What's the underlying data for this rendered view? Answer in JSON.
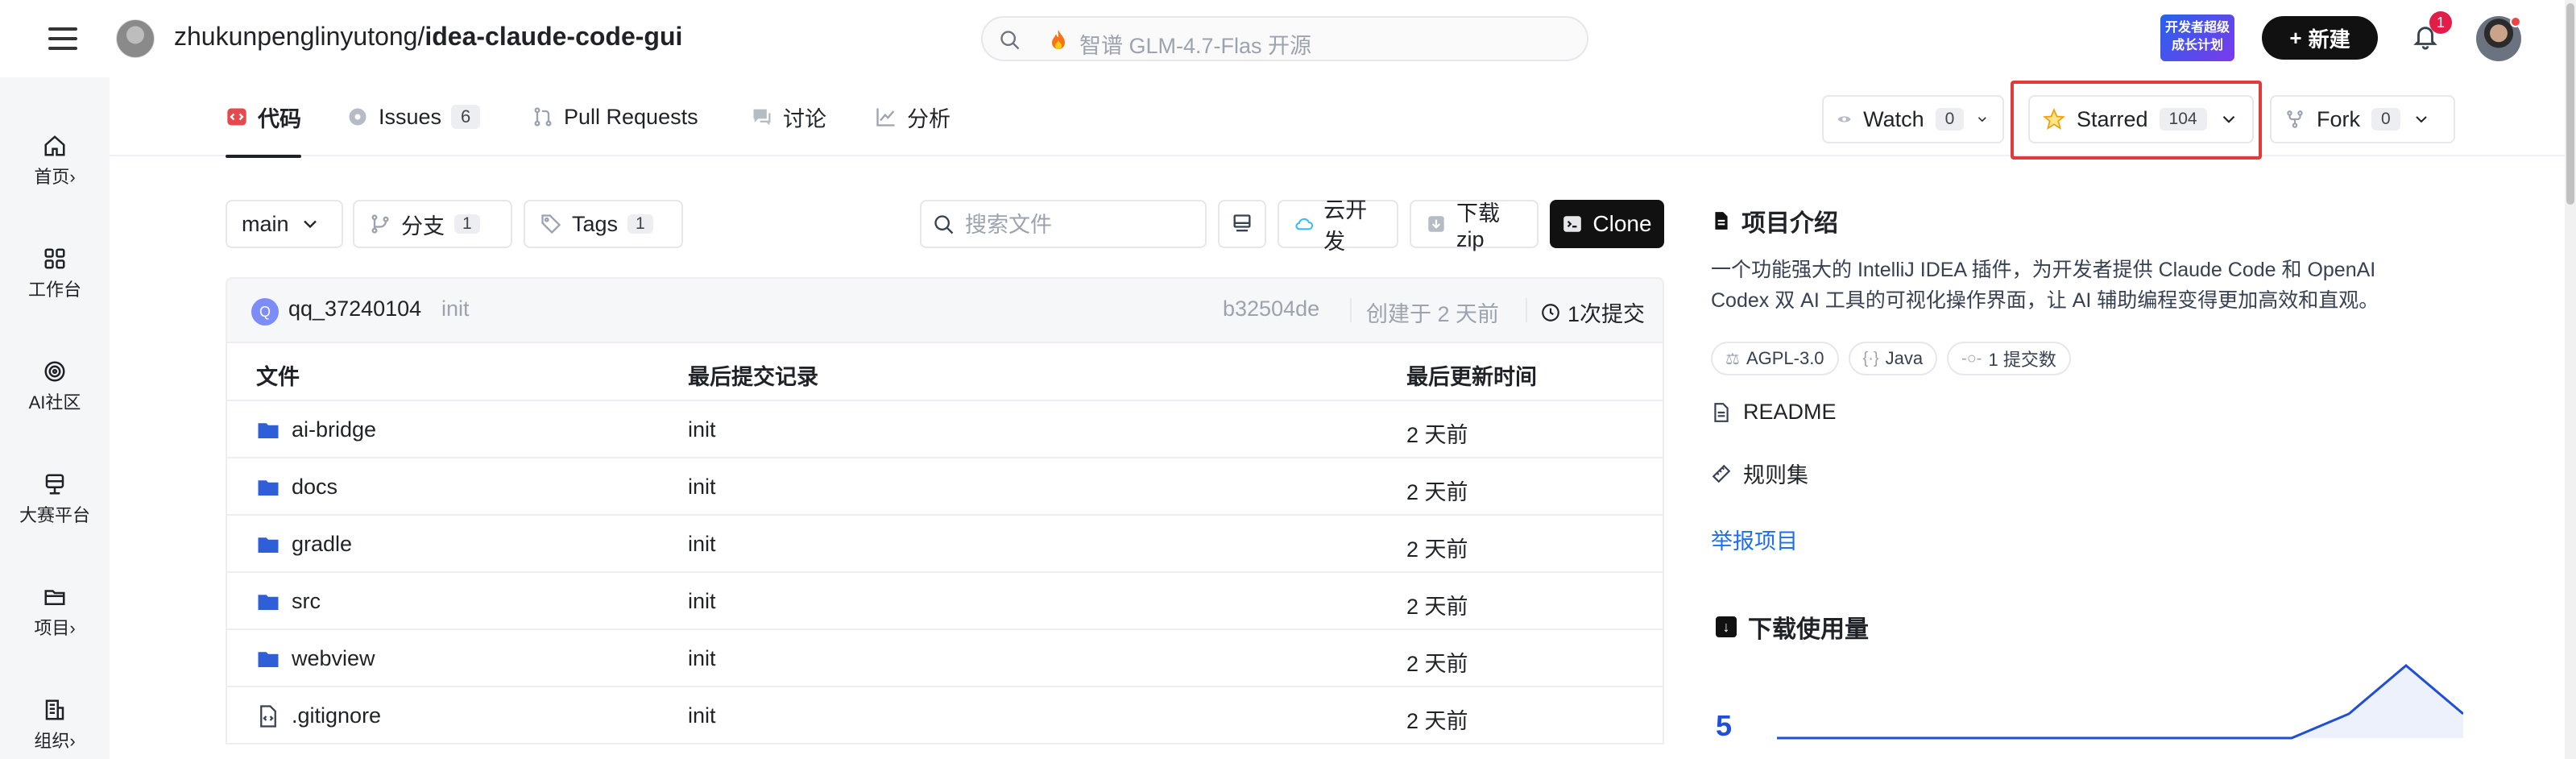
{
  "topbar": {
    "repo_owner": "zhukunpenglinyutong",
    "repo_sep": "/",
    "repo_name": "idea-claude-code-gui",
    "search_placeholder": "智谱 GLM-4.7-Flas 开源",
    "promo_badge": "开发者超级 成长计划",
    "new_button": "新建",
    "notification_count": "1"
  },
  "sidebar": {
    "items": [
      {
        "label": "首页",
        "chevron": "›",
        "icon": "home-icon"
      },
      {
        "label": "工作台",
        "icon": "grid-icon"
      },
      {
        "label": "AI社区",
        "icon": "ai-icon"
      },
      {
        "label": "大赛平台",
        "icon": "trophy-icon"
      },
      {
        "label": "项目",
        "chevron": "›",
        "icon": "folder-icon"
      },
      {
        "label": "组织",
        "chevron": "›",
        "icon": "building-icon"
      }
    ]
  },
  "tabs": [
    {
      "label": "代码",
      "icon": "code-icon"
    },
    {
      "label": "Issues",
      "count": "6",
      "icon": "issue-icon"
    },
    {
      "label": "Pull Requests",
      "icon": "pull-request-icon"
    },
    {
      "label": "讨论",
      "icon": "chat-icon"
    },
    {
      "label": "分析",
      "icon": "chart-icon"
    }
  ],
  "repo_actions": {
    "watch": {
      "label": "Watch",
      "count": "0"
    },
    "star": {
      "label": "Starred",
      "count": "104"
    },
    "fork": {
      "label": "Fork",
      "count": "0"
    }
  },
  "toolbar": {
    "branch": "main",
    "branches_label": "分支",
    "branches_count": "1",
    "tags_label": "Tags",
    "tags_count": "1",
    "search_placeholder": "搜索文件",
    "cloud_dev": "云开发",
    "download_zip": "下载zip",
    "clone": "Clone"
  },
  "last_commit": {
    "avatar_letter": "Q",
    "user": "qq_37240104",
    "message": "init",
    "hash": "b32504de",
    "created": "创建于 2 天前",
    "commits": "1次提交"
  },
  "file_table": {
    "headers": [
      "文件",
      "最后提交记录",
      "最后更新时间"
    ],
    "rows": [
      {
        "name": "ai-bridge",
        "type": "folder",
        "commit": "init",
        "time": "2 天前"
      },
      {
        "name": "docs",
        "type": "folder",
        "commit": "init",
        "time": "2 天前"
      },
      {
        "name": "gradle",
        "type": "folder",
        "commit": "init",
        "time": "2 天前"
      },
      {
        "name": "src",
        "type": "folder",
        "commit": "init",
        "time": "2 天前"
      },
      {
        "name": "webview",
        "type": "folder",
        "commit": "init",
        "time": "2 天前"
      },
      {
        "name": ".gitignore",
        "type": "file",
        "commit": "init",
        "time": "2 天前"
      }
    ]
  },
  "about": {
    "title": "项目介绍",
    "description": "一个功能强大的 IntelliJ IDEA 插件，为开发者提供 Claude Code 和 OpenAI Codex 双 AI 工具的可视化操作界面，让 AI 辅助编程变得更加高效和直观。",
    "tags": [
      "AGPL-3.0",
      "Java",
      "1 提交数"
    ],
    "readme": "README",
    "rules": "规则集",
    "report": "举报项目"
  },
  "downloads": {
    "title": "下载使用量",
    "value": "5",
    "chart_data": {
      "type": "area",
      "values": [
        0,
        0,
        0,
        0,
        0,
        0,
        0,
        0,
        0,
        0,
        1,
        3,
        1
      ],
      "color": "#1f4fd6"
    }
  },
  "colors": {
    "accent": "#1f6feb",
    "highlight_border": "#e03a3a",
    "folder": "#2f5fd8"
  }
}
